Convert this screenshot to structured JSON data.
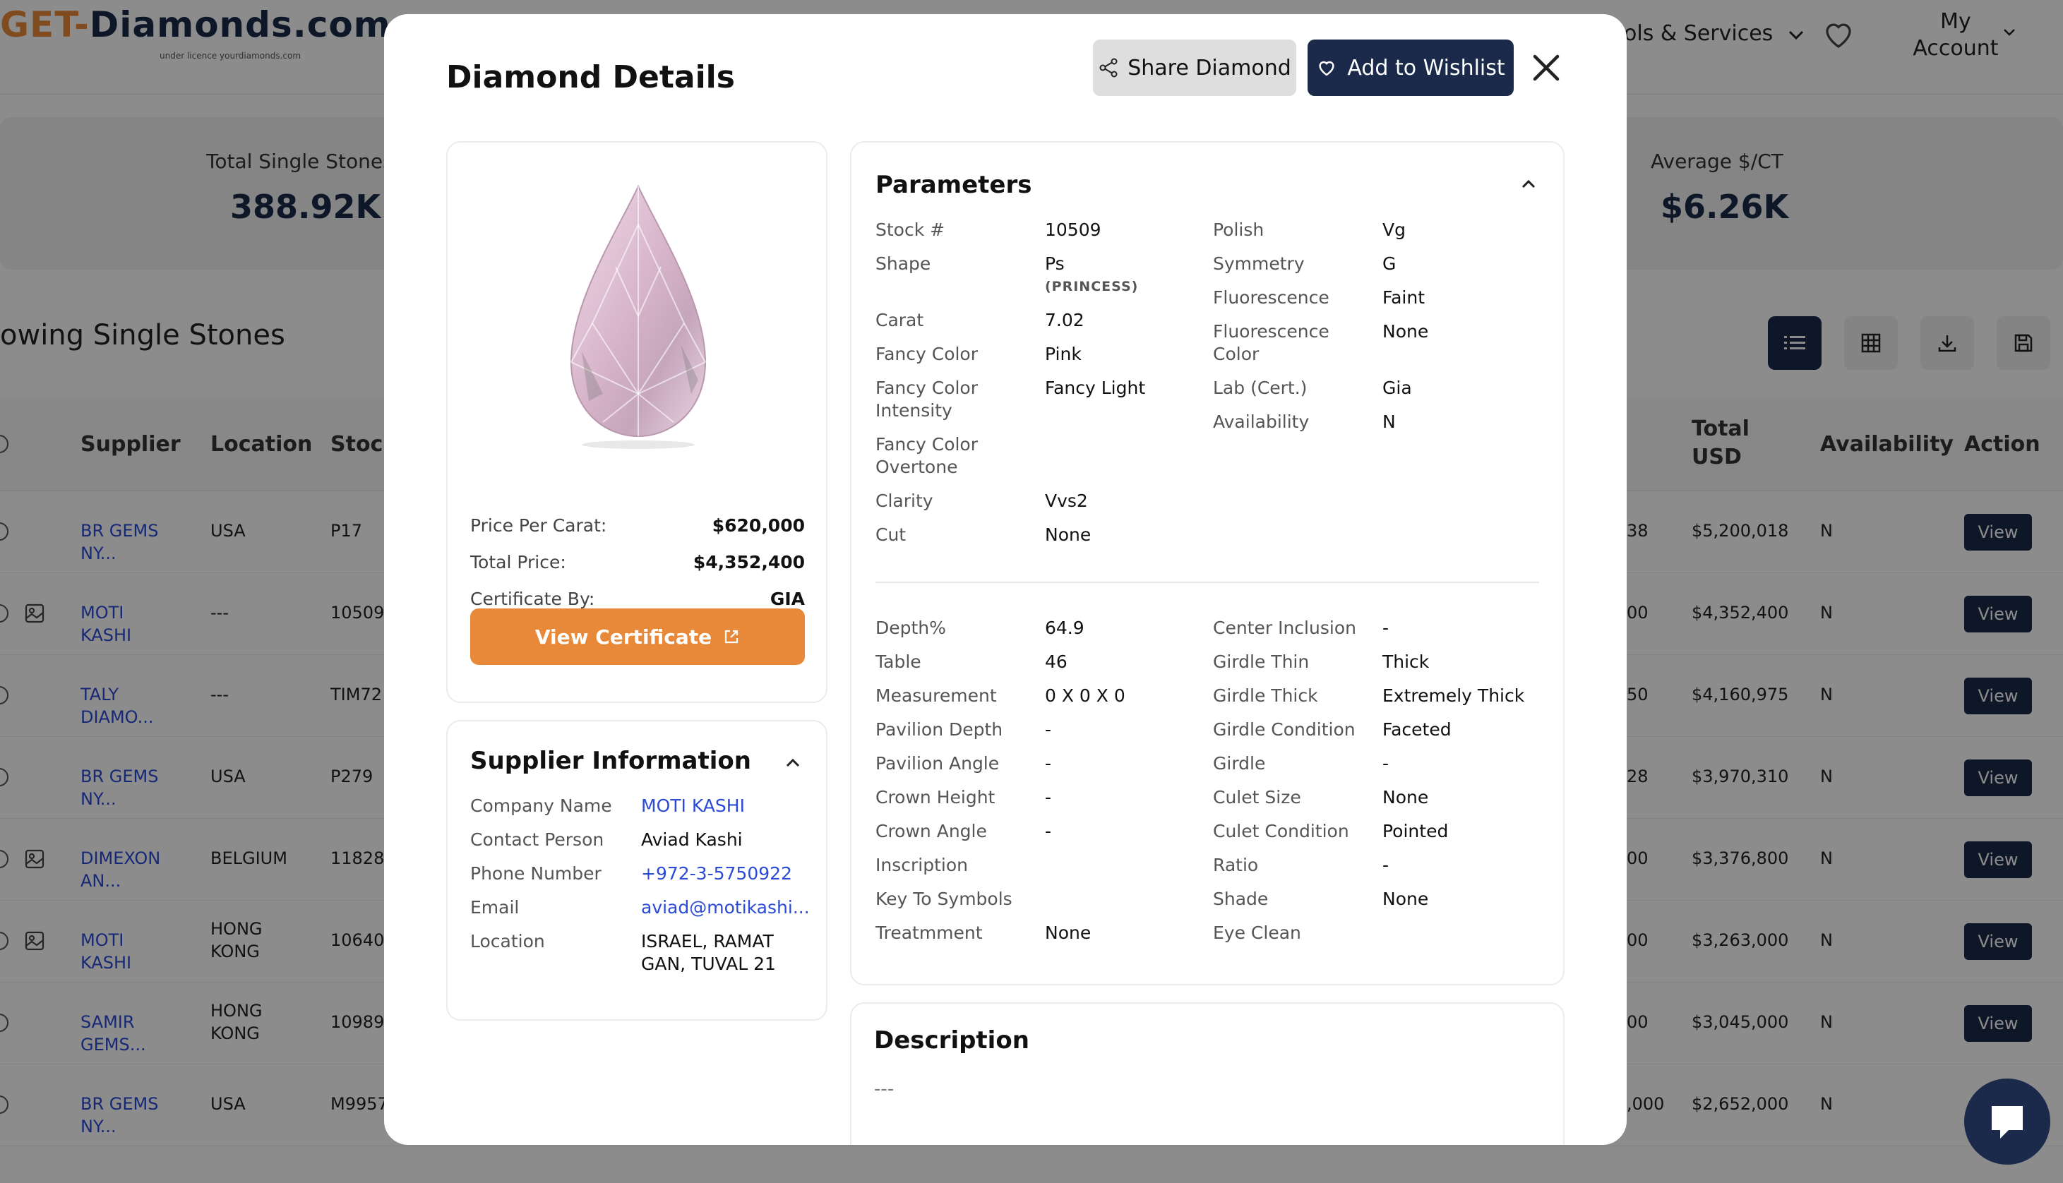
{
  "header": {
    "logo_main": "GET-Diamonds.com",
    "logo_sub": "under licence yourdiamonds.com",
    "nav_tools": "ols & Services",
    "account": "My Account"
  },
  "stats": [
    {
      "label": "Total Single Stones",
      "value": "388.92K"
    },
    {
      "label": "Average $/CT",
      "value": "$6.26K"
    }
  ],
  "list_title": "owing Single Stones",
  "table": {
    "headers": {
      "supplier": "Supplier",
      "location": "Location",
      "stock": "Stock",
      "total": "Total USD",
      "availability": "Availability",
      "action": "Action"
    },
    "rows": [
      {
        "supplier": "BR GEMS NY...",
        "location": "USA",
        "stock": "P17",
        "partial": "38",
        "total": "$5,200,018",
        "availability": "N",
        "action": "View"
      },
      {
        "supplier": "MOTI KASHI",
        "location": "---",
        "stock": "10509",
        "partial": "00",
        "total": "$4,352,400",
        "availability": "N",
        "action": "View"
      },
      {
        "supplier": "TALY DIAMO...",
        "location": "---",
        "stock": "TIM72",
        "partial": "50",
        "total": "$4,160,975",
        "availability": "N",
        "action": "View"
      },
      {
        "supplier": "BR GEMS NY...",
        "location": "USA",
        "stock": "P279",
        "partial": "28",
        "total": "$3,970,310",
        "availability": "N",
        "action": "View"
      },
      {
        "supplier": "DIMEXON AN...",
        "location": "BELGIUM",
        "stock": "11828",
        "partial": "00",
        "total": "$3,376,800",
        "availability": "N",
        "action": "View"
      },
      {
        "supplier": "MOTI KASHI",
        "location": "HONG KONG",
        "stock": "10640",
        "partial": "00",
        "total": "$3,263,000",
        "availability": "N",
        "action": "View"
      },
      {
        "supplier": "SAMIR GEMS...",
        "location": "HONG KONG",
        "stock": "10989",
        "partial": "00",
        "total": "$3,045,000",
        "availability": "N",
        "action": "View"
      },
      {
        "supplier": "BR GEMS NY...",
        "location": "USA",
        "stock": "M9957",
        "partial": ",000",
        "total": "$2,652,000",
        "availability": "N",
        "action": ""
      }
    ]
  },
  "modal": {
    "title": "Diamond Details",
    "share_label": "Share Diamond",
    "wishlist_label": "Add to Wishlist",
    "price_per_carat_label": "Price Per Carat:",
    "price_per_carat": "$620,000",
    "total_price_label": "Total Price:",
    "total_price": "$4,352,400",
    "certificate_by_label": "Certificate By:",
    "certificate_by": "GIA",
    "view_certificate": "View Certificate",
    "supplier": {
      "title": "Supplier Information",
      "rows": [
        {
          "k": "Company Name",
          "v": "MOTI KASHI"
        },
        {
          "k": "Contact Person",
          "v": "Aviad Kashi"
        },
        {
          "k": "Phone Number",
          "v": "+972-3-5750922"
        },
        {
          "k": "Email",
          "v": "aviad@motikashi..."
        },
        {
          "k": "Location",
          "v": "ISRAEL, RAMAT GAN, TUVAL 21"
        }
      ]
    },
    "parameters": {
      "title": "Parameters",
      "left_a": [
        {
          "k": "Stock #",
          "v": "10509"
        },
        {
          "k": "Shape",
          "v": "Ps",
          "sub": "(PRINCESS)"
        },
        {
          "k": "Carat",
          "v": "7.02"
        },
        {
          "k": "Fancy Color",
          "v": "Pink"
        },
        {
          "k": "Fancy Color Intensity",
          "v": "Fancy Light"
        },
        {
          "k": "Fancy Color Overtone",
          "v": ""
        },
        {
          "k": "Clarity",
          "v": "Vvs2"
        },
        {
          "k": "Cut",
          "v": "None"
        }
      ],
      "right_a": [
        {
          "k": "Polish",
          "v": "Vg"
        },
        {
          "k": "Symmetry",
          "v": "G"
        },
        {
          "k": "Fluorescence",
          "v": "Faint"
        },
        {
          "k": "Fluorescence Color",
          "v": "None"
        },
        {
          "k": "Lab (Cert.)",
          "v": "Gia"
        },
        {
          "k": "Availability",
          "v": "N"
        }
      ],
      "left_b": [
        {
          "k": "Depth%",
          "v": "64.9"
        },
        {
          "k": "Table",
          "v": "46"
        },
        {
          "k": "Measurement",
          "v": "0 X 0 X 0"
        },
        {
          "k": "Pavilion Depth",
          "v": "-"
        },
        {
          "k": "Pavilion Angle",
          "v": "-"
        },
        {
          "k": "Crown Height",
          "v": "-"
        },
        {
          "k": "Crown Angle",
          "v": "-"
        },
        {
          "k": "Inscription",
          "v": ""
        },
        {
          "k": "Key To Symbols",
          "v": ""
        },
        {
          "k": "Treatmment",
          "v": "None"
        }
      ],
      "right_b": [
        {
          "k": "Center Inclusion",
          "v": "-"
        },
        {
          "k": "Girdle Thin",
          "v": "Thick"
        },
        {
          "k": "Girdle Thick",
          "v": "Extremely Thick"
        },
        {
          "k": "Girdle Condition",
          "v": "Faceted"
        },
        {
          "k": "Girdle",
          "v": "-"
        },
        {
          "k": "Culet Size",
          "v": "None"
        },
        {
          "k": "Culet Condition",
          "v": "Pointed"
        },
        {
          "k": "Ratio",
          "v": "-"
        },
        {
          "k": "Shade",
          "v": "None"
        },
        {
          "k": "Eye Clean",
          "v": ""
        }
      ]
    },
    "description": {
      "title": "Description",
      "text": "---"
    }
  },
  "colors": {
    "navy": "#1b2a4a",
    "orange": "#e8893a",
    "link_blue": "#2b4bd6"
  },
  "icons": [
    "heart-icon",
    "chevron-down-icon",
    "list-icon",
    "grid-icon",
    "download-icon",
    "save-icon",
    "share-icon",
    "close-icon",
    "external-link-icon",
    "chevron-up-icon",
    "chat-icon",
    "image-icon"
  ]
}
